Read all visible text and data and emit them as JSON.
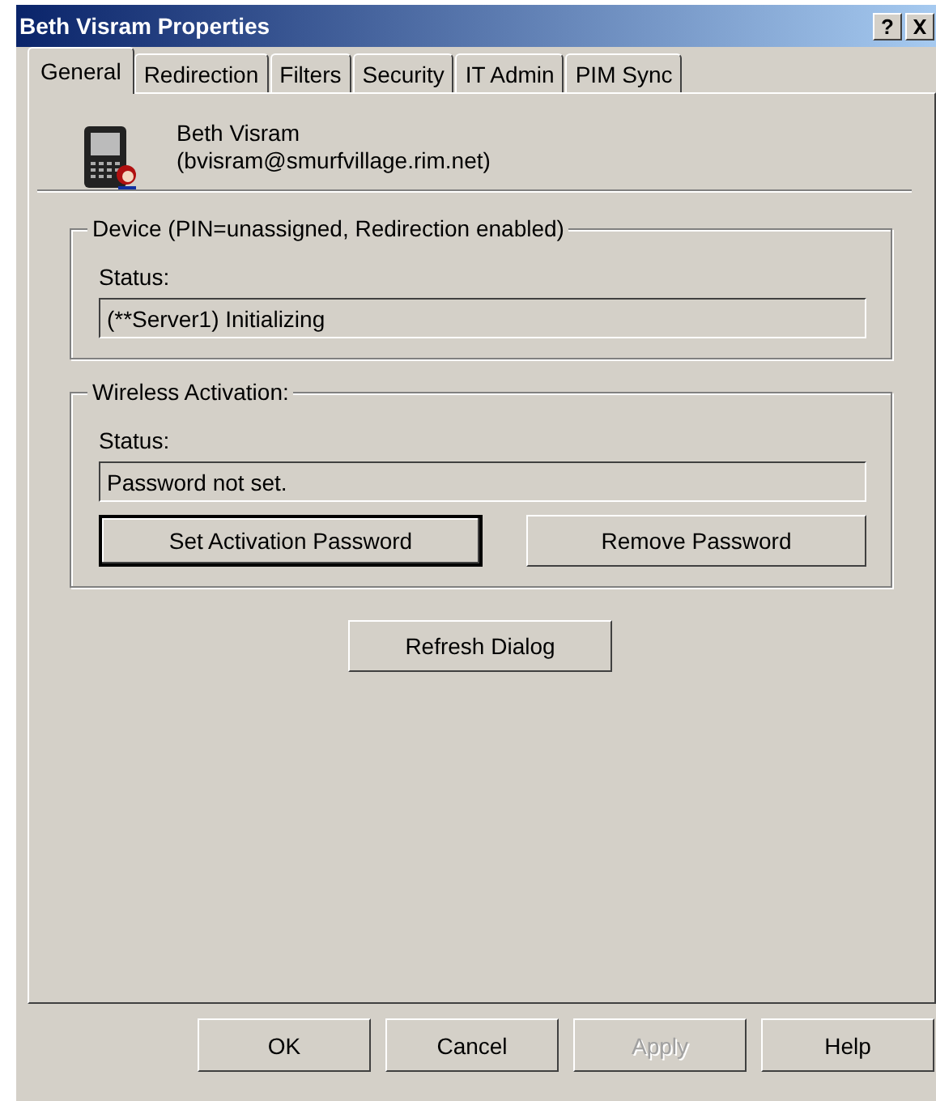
{
  "window": {
    "title": "Beth Visram Properties",
    "help_glyph": "?"
  },
  "tabs": [
    {
      "label": "General",
      "selected": true
    },
    {
      "label": "Redirection",
      "selected": false
    },
    {
      "label": "Filters",
      "selected": false
    },
    {
      "label": "Security",
      "selected": false
    },
    {
      "label": "IT Admin",
      "selected": false
    },
    {
      "label": "PIM Sync",
      "selected": false
    }
  ],
  "user": {
    "name": "Beth Visram",
    "email": "(bvisram@smurfvillage.rim.net)"
  },
  "groups": [
    {
      "title": "Device (PIN=unassigned, Redirection enabled)",
      "status_label": "Status:",
      "status_value": "(**Server1) Initializing"
    },
    {
      "title": "Wireless Activation:",
      "status_label": "Status:",
      "status_value": "Password not set.",
      "buttons": [
        {
          "label": "Set Activation Password",
          "default": true
        },
        {
          "label": "Remove Password",
          "default": false
        }
      ]
    }
  ],
  "refresh_button": "Refresh Dialog",
  "footer_buttons": [
    {
      "label": "OK",
      "disabled": false
    },
    {
      "label": "Cancel",
      "disabled": false
    },
    {
      "label": "Apply",
      "disabled": true
    },
    {
      "label": "Help",
      "disabled": false
    }
  ]
}
